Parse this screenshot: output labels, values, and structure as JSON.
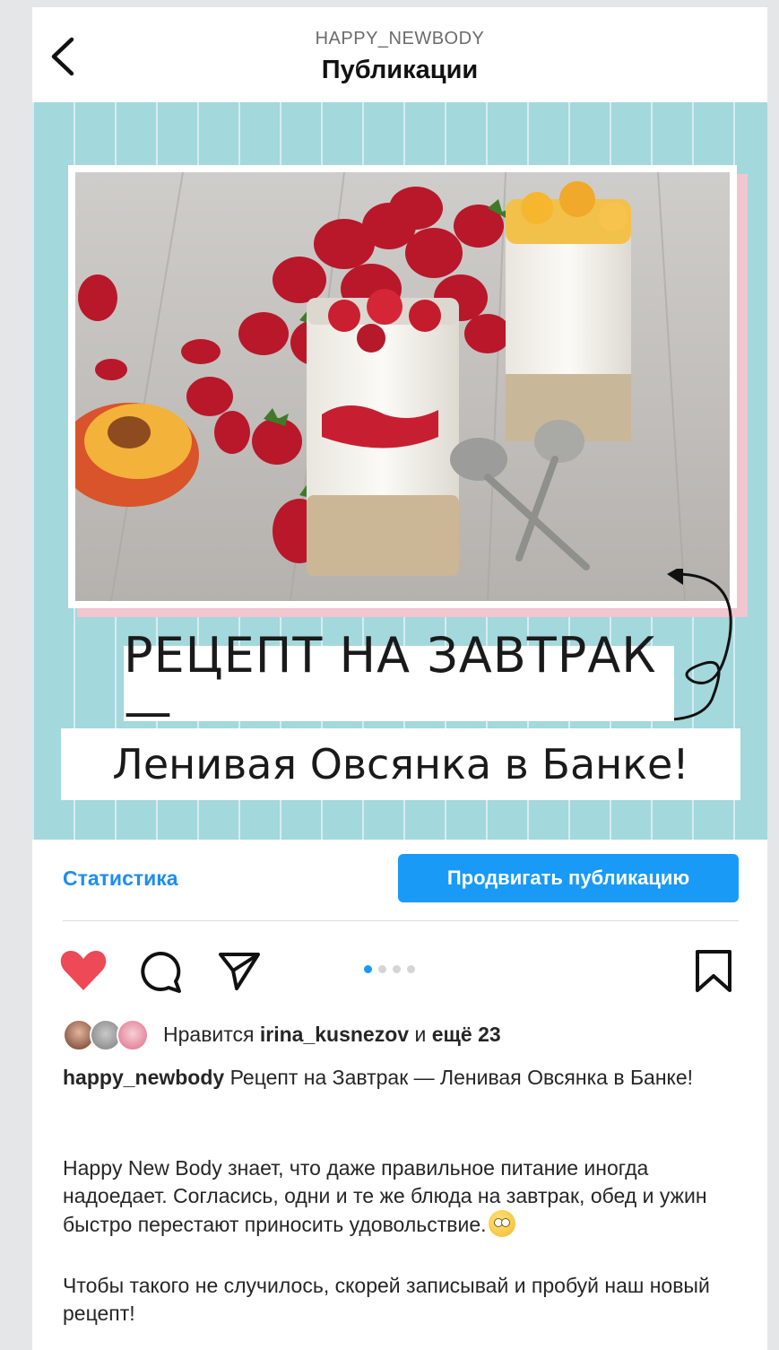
{
  "header": {
    "username": "HAPPY_NEWBODY",
    "title": "Публикации",
    "back_icon": "chevron-left-icon"
  },
  "post": {
    "title_line_1": "РЕЦЕПТ НА ЗАВТРАК —",
    "title_line_2": "Ленивая Овсянка в Банке!",
    "colors": {
      "background": "#a3d8dd",
      "frame_shadow": "#f2c6cf"
    }
  },
  "actions": {
    "statistics_label": "Статистика",
    "promote_label": "Продвигать публикацию",
    "like_icon": "heart-filled-icon",
    "comment_icon": "comment-icon",
    "share_icon": "paper-plane-icon",
    "save_icon": "bookmark-icon",
    "carousel": {
      "count": 4,
      "active_index": 0
    },
    "accent_color": "#1a9af7",
    "like_color": "#ed4956"
  },
  "likes": {
    "prefix": "Нравится",
    "user": "irina_kusnezov",
    "middle": "и",
    "others": "ещё 23"
  },
  "caption": {
    "author": "happy_newbody",
    "text": "Рецепт на Завтрак — Ленивая Овсянка в Банке!",
    "paragraph_1": "Happy New Body знает, что даже правильное питание иногда надоедает. Согласись, одни и те же блюда на завтрак, обед и ужин быстро перестают приносить удовольствие.",
    "paragraph_2": "Чтобы такого не случилось, скорей записывай и пробуй наш новый рецепт!"
  }
}
